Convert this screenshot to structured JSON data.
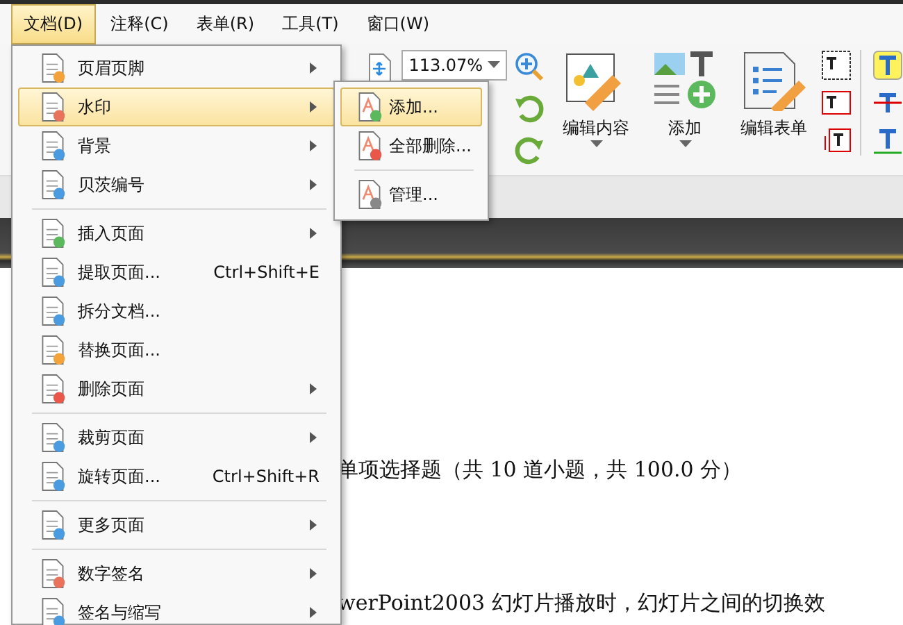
{
  "menu_bar": [
    {
      "label": "文档(D)",
      "selected": true
    },
    {
      "label": "注释(C)",
      "selected": false
    },
    {
      "label": "表单(R)",
      "selected": false
    },
    {
      "label": "工具(T)",
      "selected": false
    },
    {
      "label": "窗口(W)",
      "selected": false
    }
  ],
  "toolbar": {
    "zoom": "113.07%",
    "buttons": [
      {
        "label": "编辑内容",
        "dropdown": true
      },
      {
        "label": "添加",
        "dropdown": true
      },
      {
        "label": "编辑表单",
        "dropdown": false
      }
    ]
  },
  "document": {
    "lines": [
      "单项选择题（共 10 道小题，共 100.0 分）",
      "werPoint2003 幻灯片播放时，幻灯片之间的切换效"
    ]
  },
  "menu": {
    "groups": [
      [
        {
          "label": "页眉页脚",
          "submenu": true,
          "selected": false
        },
        {
          "label": "水印",
          "submenu": true,
          "selected": true
        },
        {
          "label": "背景",
          "submenu": true,
          "selected": false
        },
        {
          "label": "贝茨编号",
          "submenu": true,
          "selected": false
        }
      ],
      [
        {
          "label": "插入页面",
          "submenu": true,
          "selected": false
        },
        {
          "label": "提取页面...",
          "shortcut": "Ctrl+Shift+E",
          "submenu": false,
          "selected": false
        },
        {
          "label": "拆分文档...",
          "submenu": false,
          "selected": false
        },
        {
          "label": "替换页面...",
          "submenu": false,
          "selected": false
        },
        {
          "label": "删除页面",
          "submenu": true,
          "selected": false
        }
      ],
      [
        {
          "label": "裁剪页面",
          "submenu": true,
          "selected": false
        },
        {
          "label": "旋转页面...",
          "shortcut": "Ctrl+Shift+R",
          "submenu": false,
          "selected": false
        }
      ],
      [
        {
          "label": "更多页面",
          "submenu": true,
          "selected": false
        }
      ],
      [
        {
          "label": "数字签名",
          "submenu": true,
          "selected": false
        },
        {
          "label": "签名与缩写",
          "submenu": true,
          "selected": false
        }
      ]
    ]
  },
  "submenu": {
    "groups": [
      [
        {
          "label": "添加...",
          "selected": true
        },
        {
          "label": "全部删除...",
          "selected": false
        }
      ],
      [
        {
          "label": "管理...",
          "selected": false
        }
      ]
    ]
  }
}
